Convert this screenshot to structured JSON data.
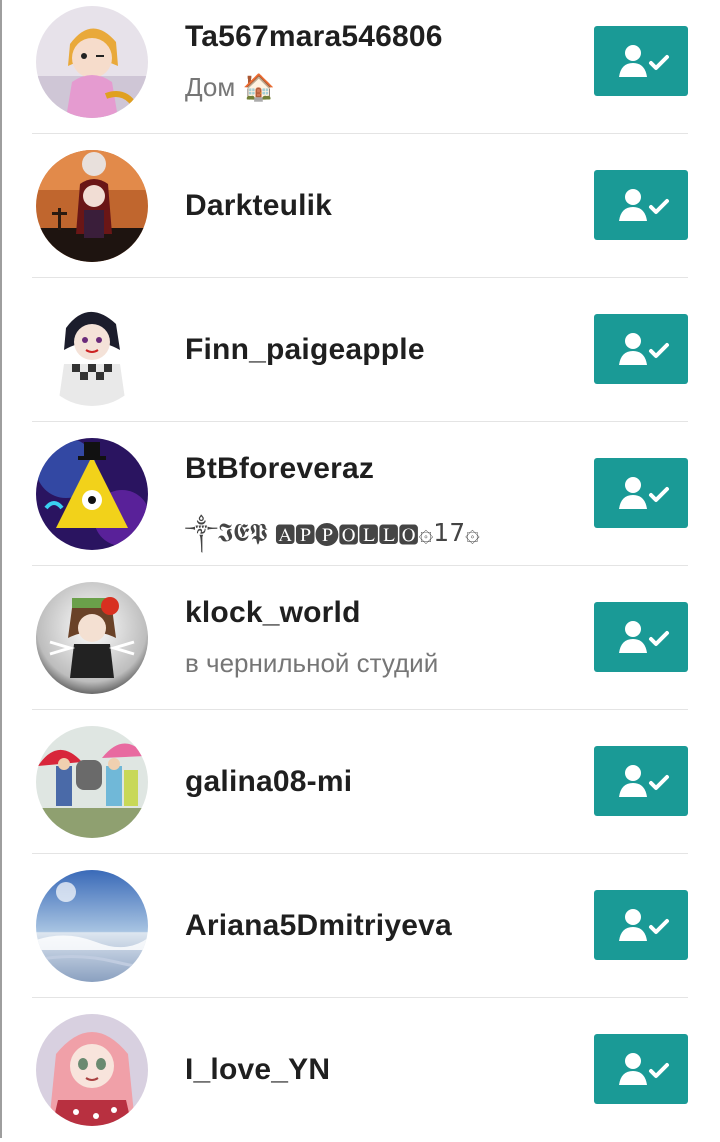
{
  "accent_color": "#1a9a96",
  "followed_icon": "user-check-icon",
  "users": [
    {
      "username": "Ta567mara546806",
      "bio": "Дом 🏠"
    },
    {
      "username": "Darkteulik",
      "bio": ""
    },
    {
      "username": "Finn_paigeapple",
      "bio": ""
    },
    {
      "username": "BtBforeveraz",
      "bio": "༒𝕴𝕰𝕻 🅰🅿🅟🅾🅻🅻🅾۞17۞"
    },
    {
      "username": "klock_world",
      "bio": "в чернильной студий"
    },
    {
      "username": "galina08-mi",
      "bio": ""
    },
    {
      "username": "Ariana5Dmitriyeva",
      "bio": ""
    },
    {
      "username": "I_love_YN",
      "bio": ""
    }
  ]
}
